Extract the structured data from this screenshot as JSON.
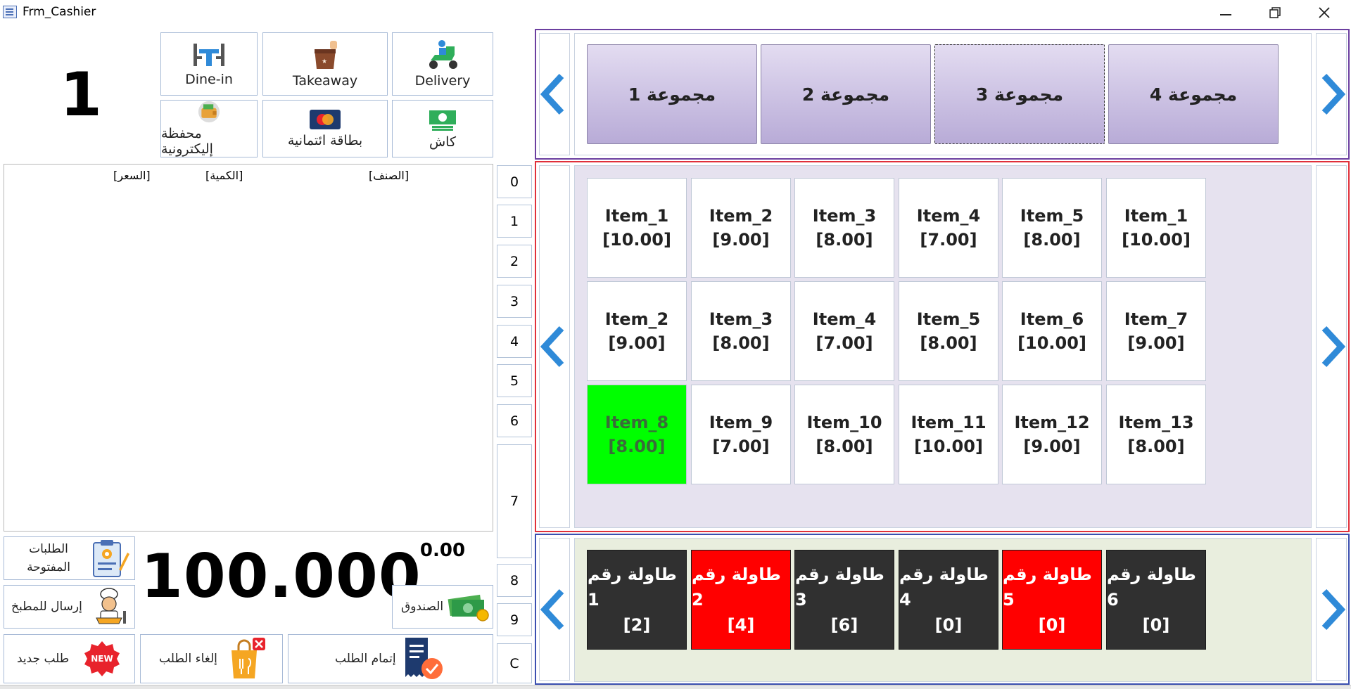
{
  "window": {
    "title": "Frm_Cashier"
  },
  "order_number": "1",
  "order_types": [
    {
      "label": "Dine-in",
      "icon": "dine-in-table-icon"
    },
    {
      "label": "Takeaway",
      "icon": "takeaway-bag-icon"
    },
    {
      "label": "Delivery",
      "icon": "delivery-scooter-icon"
    }
  ],
  "payment_methods": [
    {
      "label": "محفظة إليكترونية",
      "icon": "e-wallet-icon"
    },
    {
      "label": "بطاقة ائتمانية",
      "icon": "credit-card-icon"
    },
    {
      "label": "كاش",
      "icon": "cash-icon"
    }
  ],
  "order_grid": {
    "columns": [
      "[السعر]",
      "[الكمية]",
      "[الصنف]"
    ]
  },
  "keypad": [
    "0",
    "1",
    "2",
    "3",
    "4",
    "5",
    "6",
    "7",
    "8",
    "9",
    "C"
  ],
  "total": "100.000",
  "change": "0.00",
  "actions": {
    "open_orders": "الطلبات المفتوحة",
    "send_kitchen": "إرسال للمطبخ",
    "cash_box": "الصندوق",
    "new_order": "طلب جديد",
    "new_badge": "NEW",
    "cancel_order": "إلغاء الطلب",
    "complete_order": "إتمام الطلب"
  },
  "groups": [
    "مجموعة 1",
    "مجموعة 2",
    "مجموعة 3",
    "مجموعة 4"
  ],
  "selected_group_index": 2,
  "items": [
    {
      "name": "Item_1",
      "price": "[10.00]"
    },
    {
      "name": "Item_2",
      "price": "[9.00]"
    },
    {
      "name": "Item_3",
      "price": "[8.00]"
    },
    {
      "name": "Item_4",
      "price": "[7.00]"
    },
    {
      "name": "Item_5",
      "price": "[8.00]"
    },
    {
      "name": "Item_1",
      "price": "[10.00]"
    },
    {
      "name": "Item_2",
      "price": "[9.00]"
    },
    {
      "name": "Item_3",
      "price": "[8.00]"
    },
    {
      "name": "Item_4",
      "price": "[7.00]"
    },
    {
      "name": "Item_5",
      "price": "[8.00]"
    },
    {
      "name": "Item_6",
      "price": "[10.00]"
    },
    {
      "name": "Item_7",
      "price": "[9.00]"
    },
    {
      "name": "Item_8",
      "price": "[8.00]"
    },
    {
      "name": "Item_9",
      "price": "[7.00]"
    },
    {
      "name": "Item_10",
      "price": "[8.00]"
    },
    {
      "name": "Item_11",
      "price": "[10.00]"
    },
    {
      "name": "Item_12",
      "price": "[9.00]"
    },
    {
      "name": "Item_13",
      "price": "[8.00]"
    }
  ],
  "highlighted_item_index": 12,
  "tables": [
    {
      "name": "طاولة رقم 1",
      "count": "[2]",
      "status": "free"
    },
    {
      "name": "طاولة رقم 2",
      "count": "[4]",
      "status": "occupied"
    },
    {
      "name": "طاولة رقم 3",
      "count": "[6]",
      "status": "free"
    },
    {
      "name": "طاولة رقم 4",
      "count": "[0]",
      "status": "free"
    },
    {
      "name": "طاولة رقم 5",
      "count": "[0]",
      "status": "occupied"
    },
    {
      "name": "طاولة رقم 6",
      "count": "[0]",
      "status": "free"
    }
  ],
  "colors": {
    "group_panel_border": "#6b3fa0",
    "items_panel_border": "#e0303a",
    "tables_panel_border": "#3b4fb0",
    "group_button": "#cbbfe3",
    "items_panel_bg": "#e6e2ef",
    "tables_panel_bg": "#e9eede",
    "highlight_item": "#00ff00",
    "table_free": "#303030",
    "table_occupied": "#ff0000",
    "nav_arrow": "#2f8ad8"
  }
}
